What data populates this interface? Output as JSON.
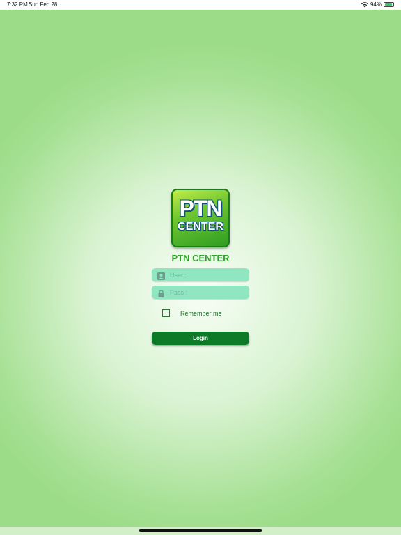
{
  "status_bar": {
    "time": "7:32 PM",
    "date": "Sun Feb 28",
    "battery_percent": "94%",
    "battery_level": 0.94,
    "icons": [
      "wifi-icon",
      "battery-icon"
    ]
  },
  "logo": {
    "line1": "PTN",
    "line2": "CENTER"
  },
  "app_title": "PTN CENTER",
  "login_form": {
    "user_placeholder": "User :",
    "user_value": "",
    "user_icon": "user-icon",
    "pass_placeholder": "Pass :",
    "pass_value": "",
    "pass_icon": "lock-icon",
    "remember_label": "Remember me",
    "remember_checked": false,
    "login_label": "Login"
  },
  "colors": {
    "accent": "#2da32a",
    "field_bg": "#8fe6c0",
    "button_bg": "#0d7a28",
    "background_edge": "#9cdc88"
  }
}
